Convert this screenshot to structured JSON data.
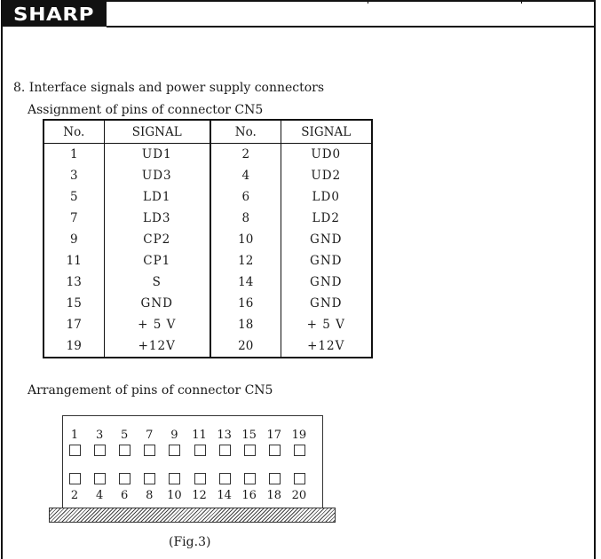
{
  "header": {
    "logo_text": "SHARP"
  },
  "section": {
    "title": "8. Interface signals and power supply connectors",
    "table_caption": "Assignment of pins of connector CN5",
    "arrangement_caption": "Arrangement of pins of connector CN5",
    "figure_caption": "(Fig.3)"
  },
  "table": {
    "headers": [
      "No.",
      "SIGNAL",
      "No.",
      "SIGNAL"
    ],
    "rows": [
      [
        "1",
        "UD1",
        "2",
        "UD0"
      ],
      [
        "3",
        "UD3",
        "4",
        "UD2"
      ],
      [
        "5",
        "LD1",
        "6",
        "LD0"
      ],
      [
        "7",
        "LD3",
        "8",
        "LD2"
      ],
      [
        "9",
        "CP2",
        "10",
        "GND"
      ],
      [
        "11",
        "CP1",
        "12",
        "GND"
      ],
      [
        "13",
        "S",
        "14",
        "GND"
      ],
      [
        "15",
        "GND",
        "16",
        "GND"
      ],
      [
        "17",
        "+ 5 V",
        "18",
        "+ 5 V"
      ],
      [
        "19",
        "+12V",
        "20",
        "+12V"
      ]
    ]
  },
  "connector": {
    "top_pins": [
      "1",
      "3",
      "5",
      "7",
      "9",
      "11",
      "13",
      "15",
      "17",
      "19"
    ],
    "bottom_pins": [
      "2",
      "4",
      "6",
      "8",
      "10",
      "12",
      "14",
      "16",
      "18",
      "20"
    ]
  }
}
